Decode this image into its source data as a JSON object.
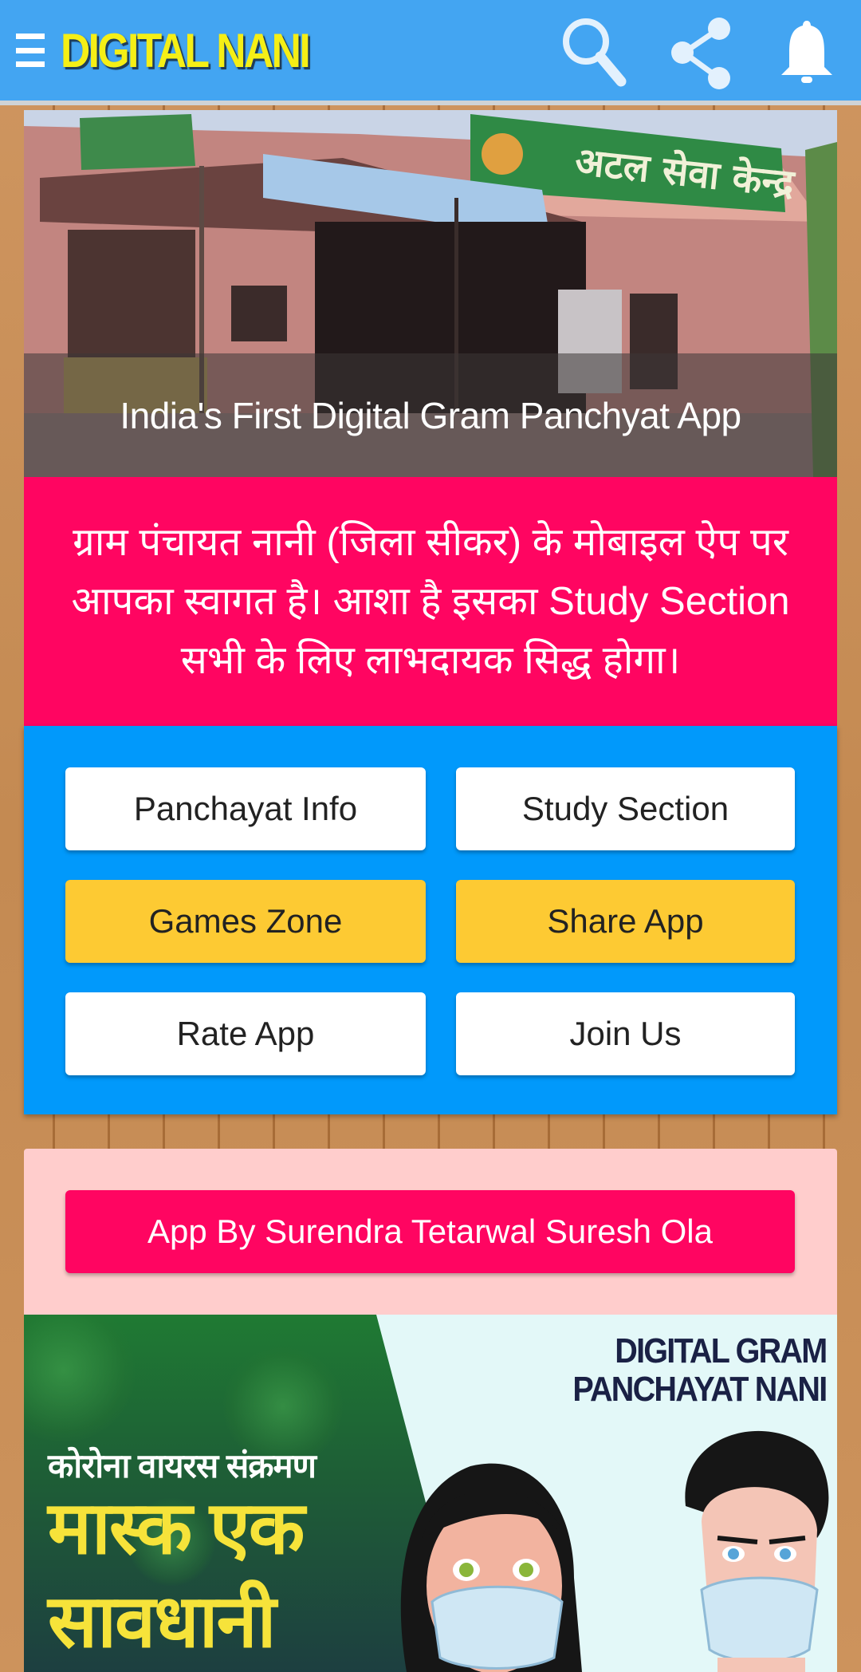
{
  "header": {
    "title": "DIGITAL NANI",
    "menu_icon": "hamburger-menu-icon",
    "actions": [
      {
        "name": "search",
        "icon": "search-icon"
      },
      {
        "name": "share",
        "icon": "share-icon"
      },
      {
        "name": "notifications",
        "icon": "bell-icon"
      }
    ],
    "colors": {
      "bar": "#43a5f2",
      "title": "#f5ef16"
    }
  },
  "hero": {
    "caption": "India's First Digital Gram Panchyat App",
    "image": "Atal Seva Kendra building photo"
  },
  "welcome": {
    "text": "ग्राम पंचायत नानी (जिला सीकर) के मोबाइल ऐप पर आपका स्वागत है। आशा है इसका Study Section सभी के लिए लाभदायक सिद्ध होगा।",
    "background": "#ff0561"
  },
  "menu_grid": {
    "background": "#0199fb",
    "buttons": [
      {
        "label": "Panchayat Info",
        "color": "#ffffff"
      },
      {
        "label": "Study Section",
        "color": "#ffffff"
      },
      {
        "label": "Games Zone",
        "color": "#fdca33"
      },
      {
        "label": "Share App",
        "color": "#fdca33"
      },
      {
        "label": "Rate App",
        "color": "#ffffff"
      },
      {
        "label": "Join Us",
        "color": "#ffffff"
      }
    ]
  },
  "credit": {
    "label": "App By Surendra Tetarwal Suresh Ola",
    "panel_color": "#ffcdcc",
    "button_color": "#ff0561"
  },
  "banner": {
    "line1": "कोरोना वायरस संक्रमण",
    "line2": "मास्क एक",
    "line3": "सावधानी",
    "title_line1": "DIGITAL GRAM",
    "title_line2": "PANCHAYAT NANI",
    "image": "two masked people illustration"
  }
}
